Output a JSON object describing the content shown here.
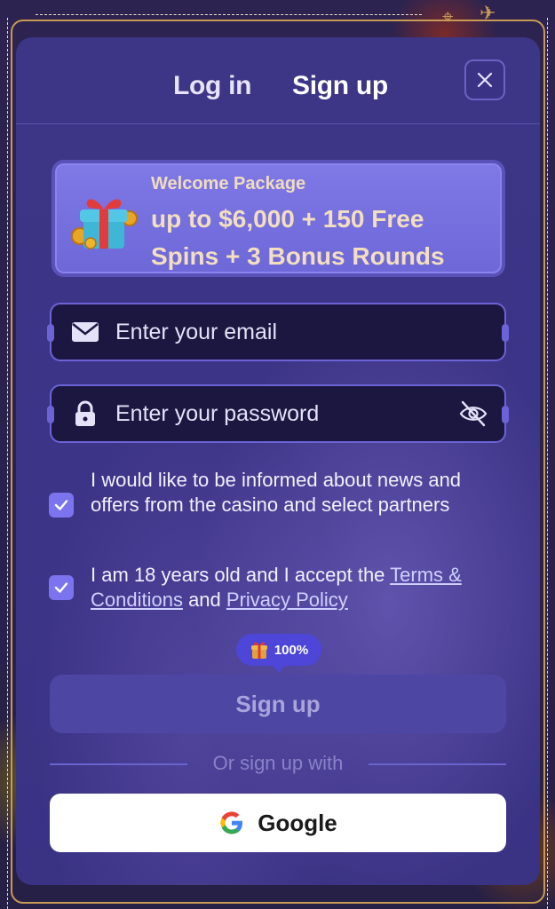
{
  "tabs": {
    "login": "Log in",
    "signup": "Sign up"
  },
  "promo": {
    "title": "Welcome Package",
    "offer": "up to $6,000 + 150 Free Spins + 3 Bonus Rounds"
  },
  "form": {
    "email_placeholder": "Enter your email",
    "password_placeholder": "Enter your password"
  },
  "consents": {
    "news": {
      "label": "I would like to be informed about news and offers from the casino and select partners",
      "checked": true
    },
    "terms": {
      "prefix": "I am 18 years old and I accept the ",
      "terms_link": "Terms & Conditions",
      "middle": " and ",
      "privacy_link": "Privacy Policy",
      "checked": true
    }
  },
  "badge": {
    "label": "100%"
  },
  "signup_button": "Sign up",
  "divider": "Or sign up with",
  "google_button": "Google",
  "colors": {
    "modal_bg": "#3c3486",
    "accent": "#7c74ee",
    "promo_text": "#f3dfbf",
    "field_bg": "#1b1740"
  },
  "icons": [
    "close-icon",
    "gift-icon",
    "mail-icon",
    "lock-icon",
    "eye-off-icon",
    "check-icon",
    "google-icon"
  ]
}
